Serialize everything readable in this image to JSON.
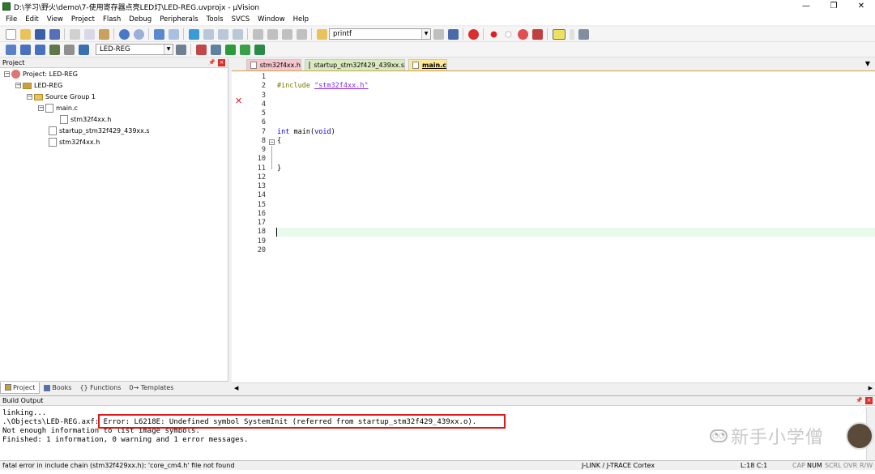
{
  "window": {
    "title": "D:\\学习\\野火\\demo\\7-使用寄存器点亮LED灯\\LED-REG.uvprojx - µVision",
    "minimize": "—",
    "restore": "❐",
    "close": "✕"
  },
  "menu": [
    "File",
    "Edit",
    "View",
    "Project",
    "Flash",
    "Debug",
    "Peripherals",
    "Tools",
    "SVCS",
    "Window",
    "Help"
  ],
  "toolbar": {
    "find_combo_value": "printf",
    "target_combo_value": "LED-REG"
  },
  "project_pane": {
    "title": "Project",
    "tree": [
      {
        "label": "Project: LED-REG",
        "level": 0
      },
      {
        "label": "LED-REG",
        "level": 1
      },
      {
        "label": "Source Group 1",
        "level": 2
      },
      {
        "label": "main.c",
        "level": 3
      },
      {
        "label": "stm32f4xx.h",
        "level": 4
      },
      {
        "label": "startup_stm32f429_439xx.s",
        "level": 3
      },
      {
        "label": "stm32f4xx.h",
        "level": 3
      }
    ],
    "tabs": [
      "Project",
      "Books",
      "{} Functions",
      "0→ Templates"
    ]
  },
  "editor": {
    "tabs": [
      "stm32f4xx.h",
      "startup_stm32f429_439xx.s",
      "main.c"
    ],
    "active_tab": "main.c",
    "line_numbers": [
      "1",
      "2",
      "3",
      "4",
      "5",
      "6",
      "7",
      "8",
      "9",
      "10",
      "11",
      "12",
      "13",
      "14",
      "15",
      "16",
      "17",
      "18",
      "19",
      "20"
    ],
    "error_line": "2",
    "current_line": "18",
    "code": {
      "include_directive": "#include ",
      "include_file": "\"stm32f4xx.h\"",
      "main_type": "int",
      "main_sig": " main(",
      "main_arg": "void",
      "main_close": ")",
      "open_brace": "{",
      "close_brace": "}"
    }
  },
  "build_output": {
    "title": "Build Output",
    "lines": [
      "linking...",
      ".\\Objects\\LED-REG.axf: Error: L6218E: Undefined symbol SystemInit (referred from startup_stm32f429_439xx.o).",
      "Not enough information to list image symbols.",
      "Finished: 1 information, 0 warning and 1 error messages."
    ]
  },
  "status": {
    "message": "fatal error in include chain (stm32f429xx.h): 'core_cm4.h' file not found",
    "debugger": "J-LINK / J-TRACE Cortex",
    "position": "L:18 C:1",
    "caps": "CAP",
    "num": "NUM",
    "scrl": "SCRL",
    "ovr": "OVR",
    "rw": "R/W"
  },
  "watermark": {
    "text": "新手小学僧"
  },
  "colors": {
    "error_red": "#e01818",
    "tab_h": "#f5c7ce",
    "tab_s": "#d9eac0",
    "tab_c": "#fde895",
    "current_line_bg": "#e8fbea"
  }
}
